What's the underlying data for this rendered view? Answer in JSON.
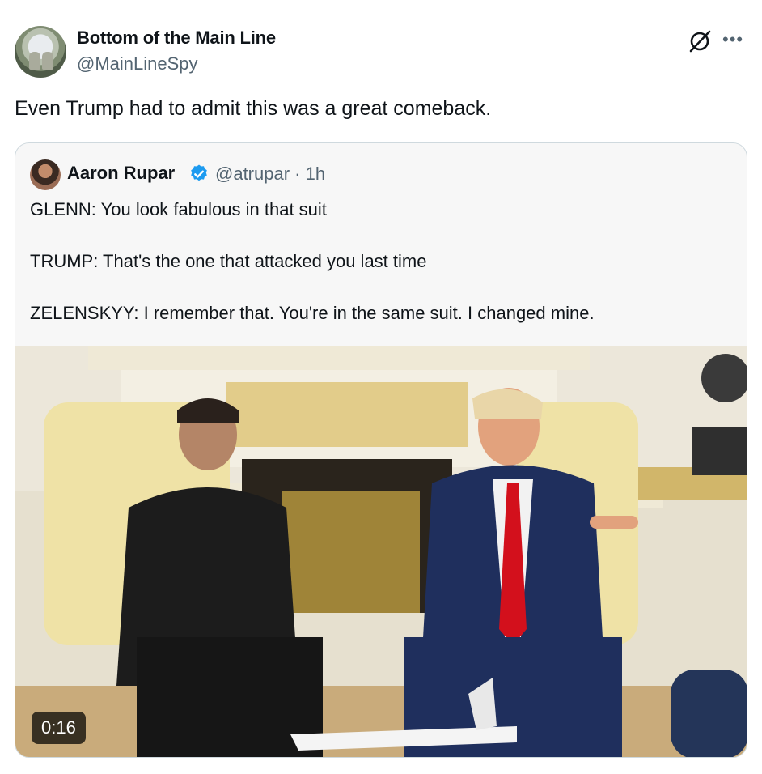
{
  "post": {
    "display_name": "Bottom of the Main Line",
    "handle": "@MainLineSpy",
    "text": "Even Trump had to admit this was a great comeback."
  },
  "quoted": {
    "display_name": "Aaron Rupar",
    "handle_time": "@atrupar · 1h",
    "lines": [
      "GLENN: You look fabulous in that suit",
      "TRUMP: That's the one that attacked you last time",
      "ZELENSKYY: I remember that. You're in the same suit. I changed mine."
    ],
    "video_duration": "0:16"
  },
  "icons": {
    "header_action": "grok-icon",
    "more": "more-icon",
    "badge": "verified-badge-icon"
  },
  "colors": {
    "verified": "#1d9bf0",
    "secondary_text": "#536471",
    "border": "#cfd9de"
  }
}
